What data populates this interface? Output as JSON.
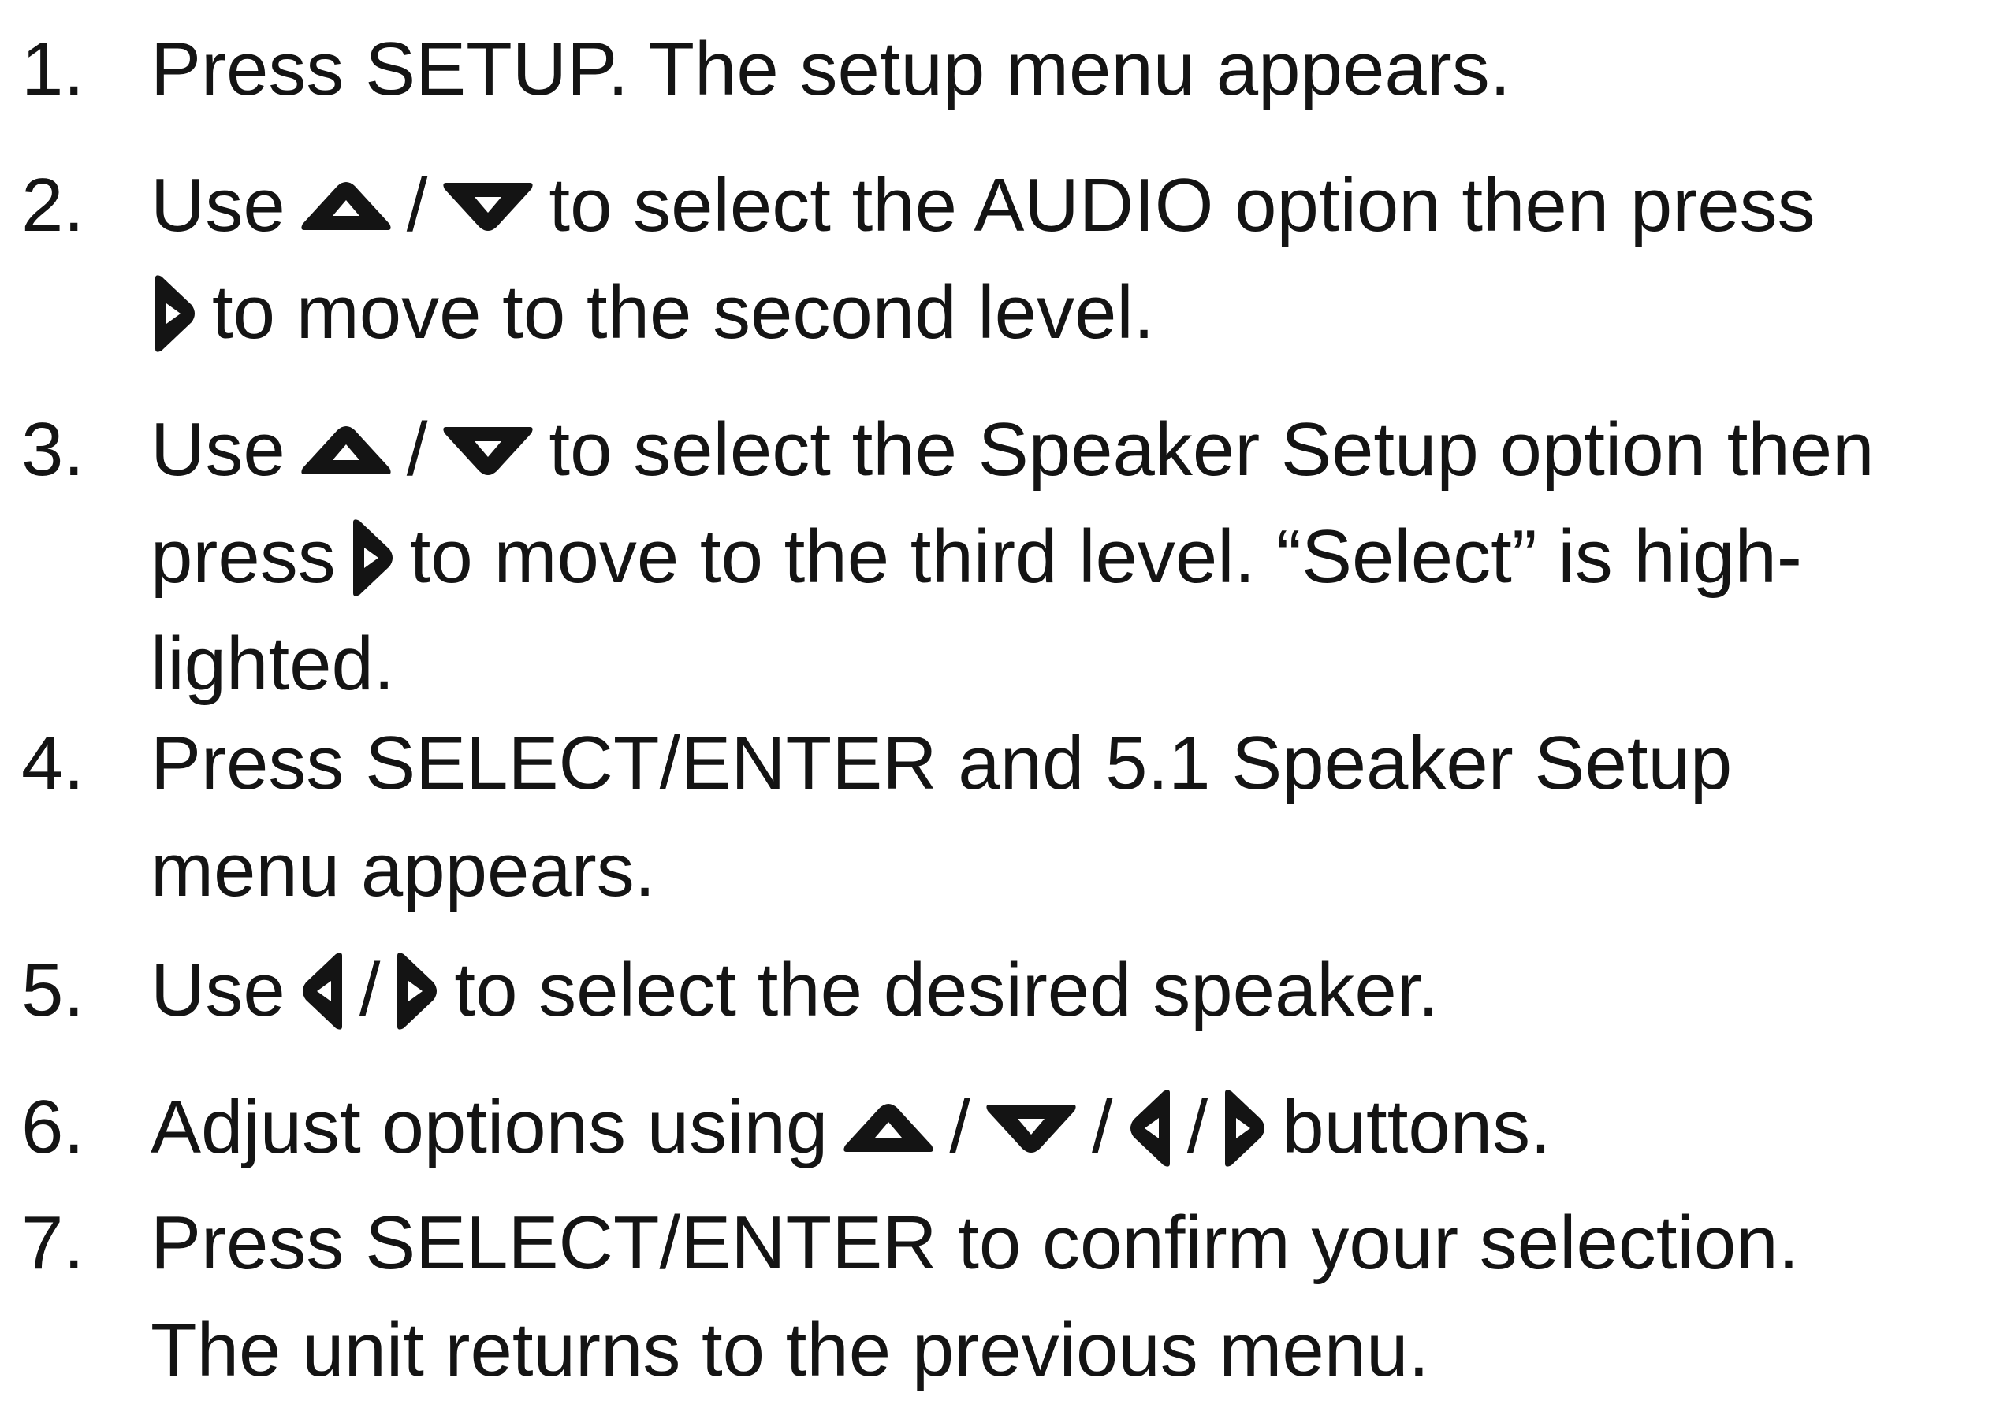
{
  "steps": [
    {
      "number": "1.",
      "lines": [
        [
          {
            "t": "Press SETUP. The setup menu appears."
          }
        ]
      ]
    },
    {
      "number": "2.",
      "lines": [
        [
          {
            "t": "Use"
          },
          {
            "icon": "up-arrow-icon"
          },
          {
            "t": "/"
          },
          {
            "icon": "down-arrow-icon"
          },
          {
            "t": "to select the AUDIO option then press"
          }
        ],
        [
          {
            "icon": "right-arrow-icon"
          },
          {
            "t": "to move to the second level."
          }
        ]
      ]
    },
    {
      "number": "3.",
      "lines": [
        [
          {
            "t": "Use"
          },
          {
            "icon": "up-arrow-icon"
          },
          {
            "t": "/"
          },
          {
            "icon": "down-arrow-icon"
          },
          {
            "t": "to select the Speaker Setup option then"
          }
        ],
        [
          {
            "t": "press"
          },
          {
            "icon": "right-arrow-icon"
          },
          {
            "t": "to move to the third level. “Select” is high-"
          }
        ],
        [
          {
            "t": "lighted."
          }
        ]
      ]
    },
    {
      "number": "4.",
      "lines": [
        [
          {
            "t": "Press SELECT/ENTER and 5.1 Speaker Setup"
          }
        ],
        [
          {
            "t": "menu appears."
          }
        ]
      ]
    },
    {
      "number": "5.",
      "lines": [
        [
          {
            "t": "Use"
          },
          {
            "icon": "left-arrow-icon"
          },
          {
            "t": "/"
          },
          {
            "icon": "right-arrow-icon"
          },
          {
            "t": "to select the desired speaker."
          }
        ]
      ]
    },
    {
      "number": "6.",
      "lines": [
        [
          {
            "t": "Adjust options using"
          },
          {
            "icon": "up-arrow-icon"
          },
          {
            "t": "/"
          },
          {
            "icon": "down-arrow-icon"
          },
          {
            "t": "/"
          },
          {
            "icon": "left-arrow-icon"
          },
          {
            "t": "/"
          },
          {
            "icon": "right-arrow-icon"
          },
          {
            "t": "buttons."
          }
        ]
      ]
    },
    {
      "number": "7.",
      "lines": [
        [
          {
            "t": "Press SELECT/ENTER to confirm your selection."
          }
        ],
        [
          {
            "t": "The unit returns to the previous menu."
          }
        ]
      ]
    }
  ]
}
